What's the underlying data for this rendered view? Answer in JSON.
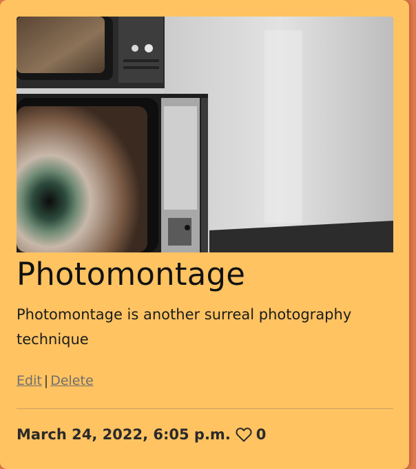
{
  "post": {
    "title": "Photomontage",
    "description": "Photomontage is another surreal photography technique",
    "edit_label": "Edit",
    "separator": "|",
    "delete_label": "Delete",
    "date": "March 24, 2022, 6:05 p.m.",
    "like_icon": "heart-outline-icon",
    "like_count": "0"
  },
  "colors": {
    "card_background": "#ffc361",
    "page_background": "#e07a4f",
    "link": "#6f6f6f"
  }
}
